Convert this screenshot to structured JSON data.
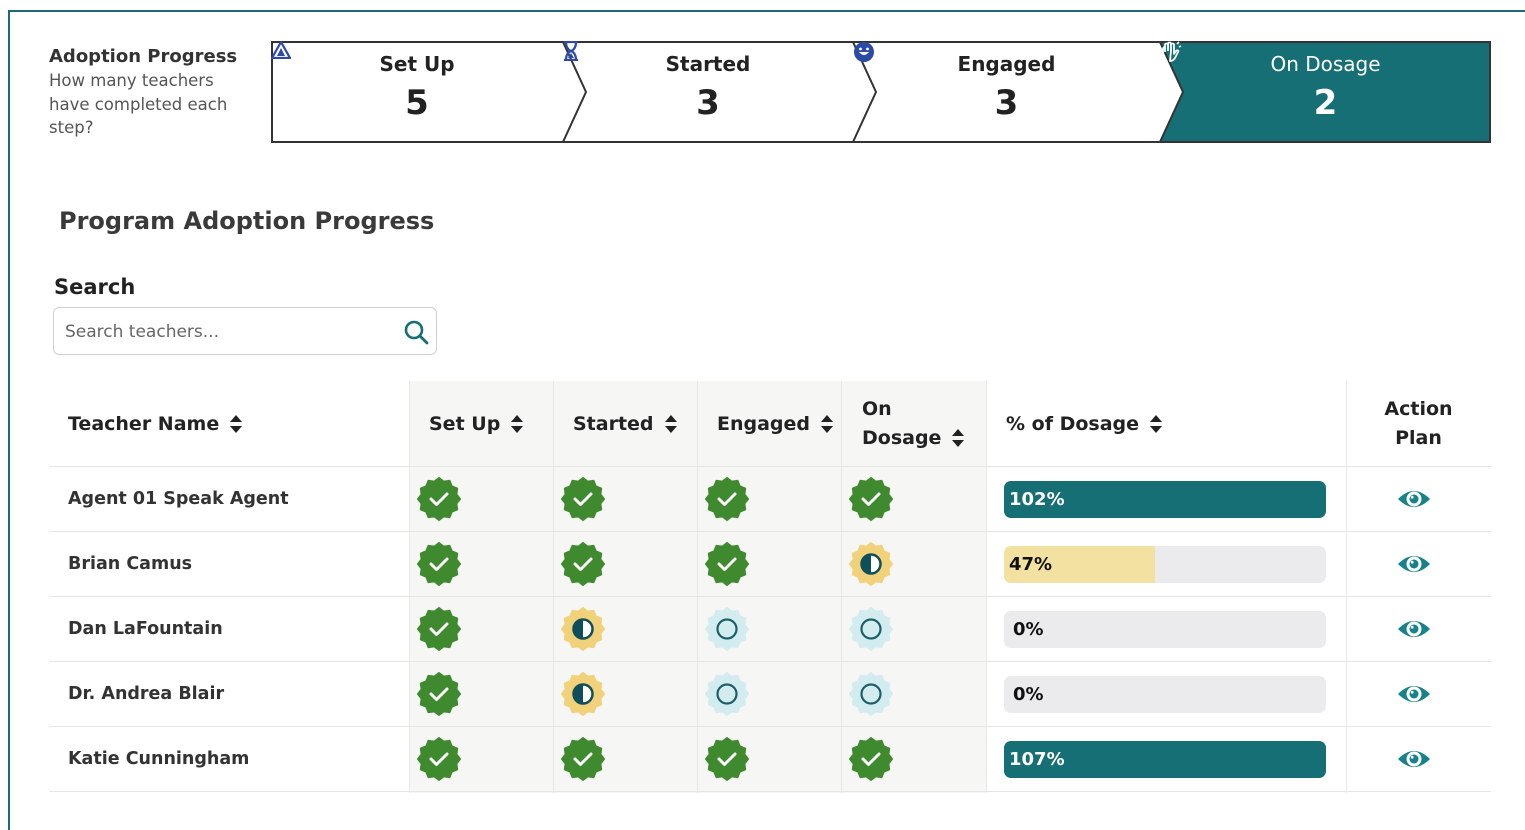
{
  "adoption": {
    "title": "Adoption Progress",
    "description": "How many teachers have completed each step?",
    "steps": [
      {
        "label": "Set Up",
        "count": "5",
        "icon": "warning-triangle-icon"
      },
      {
        "label": "Started",
        "count": "3",
        "icon": "hourglass-icon"
      },
      {
        "label": "Engaged",
        "count": "3",
        "icon": "smile-icon"
      },
      {
        "label": "On Dosage",
        "count": "2",
        "icon": "waving-hand-icon",
        "active": true
      }
    ]
  },
  "section_title": "Program Adoption Progress",
  "search": {
    "label": "Search",
    "placeholder": "Search teachers..."
  },
  "table": {
    "headers": {
      "name": "Teacher Name",
      "setup": "Set Up",
      "started": "Started",
      "engaged": "Engaged",
      "on_dosage_1": "On",
      "on_dosage_2": "Dosage",
      "pct": "% of Dosage",
      "action_1": "Action",
      "action_2": "Plan"
    },
    "rows": [
      {
        "name": "Agent 01 Speak Agent",
        "setup": "complete",
        "started": "complete",
        "engaged": "complete",
        "on_dosage": "complete",
        "pct_label": "102%",
        "pct": 1.02
      },
      {
        "name": "Brian Camus",
        "setup": "complete",
        "started": "complete",
        "engaged": "complete",
        "on_dosage": "partial",
        "pct_label": "47%",
        "pct": 0.47
      },
      {
        "name": "Dan LaFountain",
        "setup": "complete",
        "started": "partial",
        "engaged": "empty",
        "on_dosage": "empty",
        "pct_label": "0%",
        "pct": 0
      },
      {
        "name": "Dr. Andrea Blair",
        "setup": "complete",
        "started": "partial",
        "engaged": "empty",
        "on_dosage": "empty",
        "pct_label": "0%",
        "pct": 0
      },
      {
        "name": "Katie Cunningham",
        "setup": "complete",
        "started": "complete",
        "engaged": "complete",
        "on_dosage": "complete",
        "pct_label": "107%",
        "pct": 1.07
      }
    ]
  },
  "colors": {
    "teal": "#156f75",
    "green": "#3f8a2e",
    "yellow": "#f1d27a",
    "light_blue": "#d3ecf0",
    "bar_yellow": "#f2e1a0"
  }
}
